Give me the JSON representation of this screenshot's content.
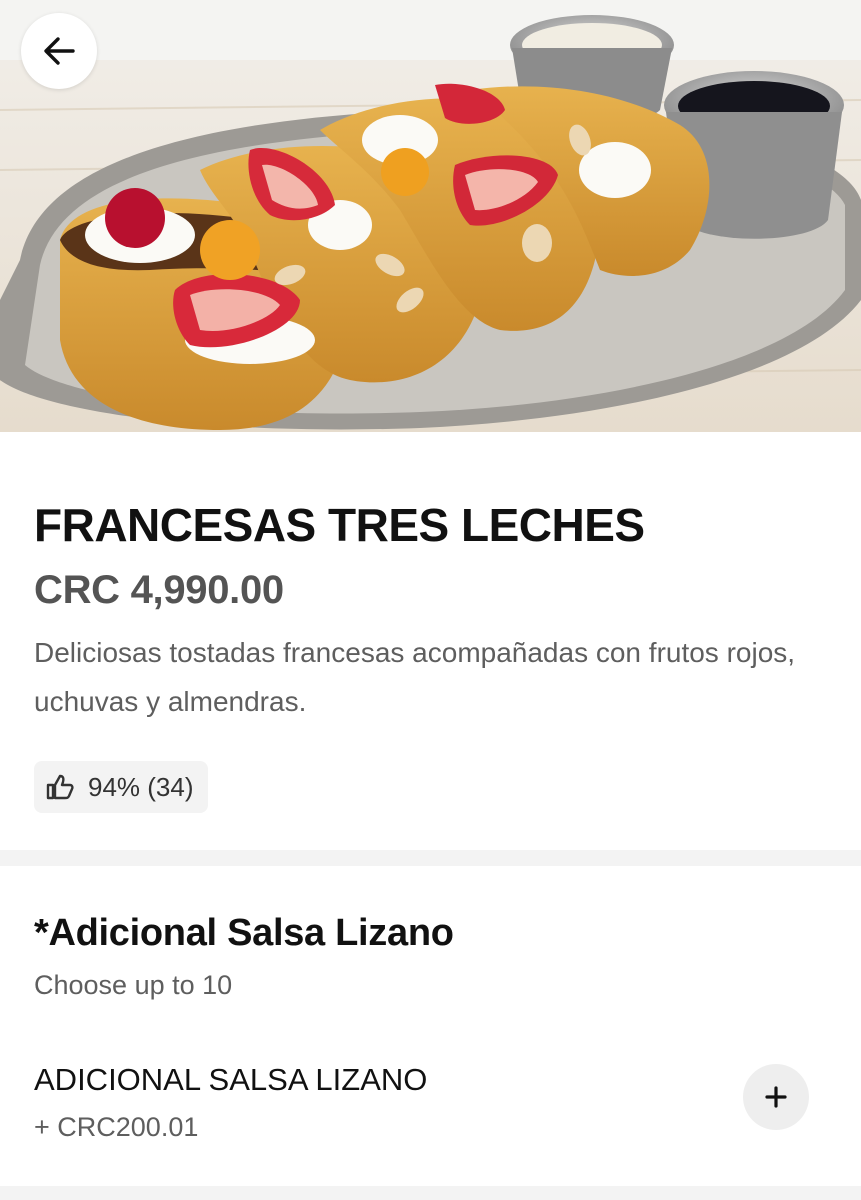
{
  "hero": {
    "image": "french-toast-dish-photo"
  },
  "nav": {
    "back_icon": "arrow-left-icon"
  },
  "product": {
    "name": "FRANCESAS TRES LECHES",
    "price": "CRC 4,990.00",
    "description": "Deliciosas tostadas francesas acompañadas con frutos rojos, uchuvas y almendras.",
    "rating": {
      "icon": "thumbs-up-icon",
      "text": "94% (34)"
    }
  },
  "option_group": {
    "title": "*Adicional Salsa Lizano",
    "subtitle": "Choose up to 10",
    "items": [
      {
        "name": "ADICIONAL SALSA LIZANO",
        "price": "+ CRC200.01",
        "add_icon": "plus-icon"
      }
    ]
  },
  "colors": {
    "text_primary": "#111111",
    "text_secondary": "#5e5e5e",
    "chip_bg": "#f3f3f3",
    "button_bg": "#eeeeee"
  }
}
